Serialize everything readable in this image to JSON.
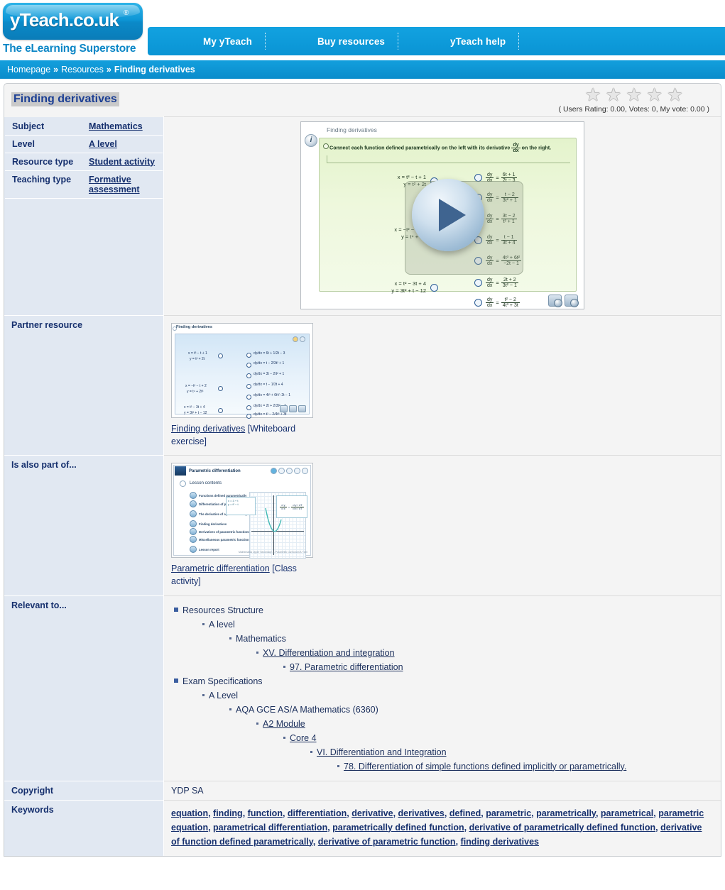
{
  "site": {
    "logo_text": "yTeach.co.uk",
    "logo_reg": "®",
    "tagline": "The eLearning Superstore"
  },
  "nav": {
    "items": [
      {
        "label": "My yTeach"
      },
      {
        "label": "Buy resources"
      },
      {
        "label": "yTeach help"
      }
    ]
  },
  "breadcrumb": {
    "home": "Homepage",
    "sep": "»",
    "resources": "Resources",
    "current": "Finding derivatives"
  },
  "page": {
    "title": "Finding derivatives"
  },
  "rating": {
    "star": "★",
    "stars_count": 5,
    "text": "( Users Rating: 0.00,   Votes: 0,   My vote: 0.00 )"
  },
  "meta": {
    "rows": [
      {
        "label": "Subject",
        "value": "Mathematics"
      },
      {
        "label": "Level",
        "value": "A level"
      },
      {
        "label": "Resource type",
        "value": "Student activity"
      },
      {
        "label": "Teaching type",
        "value": "Formative assessment"
      }
    ]
  },
  "preview": {
    "title": "Finding derivatives",
    "info_icon": "i",
    "prompt_prefix": "Connect each function defined parametrically on the left with its derivative",
    "prompt_frac_num": "dy",
    "prompt_frac_den": "dx",
    "prompt_suffix": "on the right.",
    "left_items": [
      {
        "line1": "x = t³ − t + 1",
        "line2": "y = t² + 2t"
      },
      {
        "line1": "x = −t² − t + 2",
        "line2": "y = t⁴ + 2t³"
      },
      {
        "line1": "x = t² − 3t + 4",
        "line2": "y = 3t² + t − 12"
      }
    ],
    "right_items": [
      {
        "num": "6t + 1",
        "den": "2t − 3"
      },
      {
        "num": "t − 2",
        "den": "3t² + 1"
      },
      {
        "num": "3t − 2",
        "den": "t² + 1"
      },
      {
        "num": "t − 1",
        "den": "3t + 4"
      },
      {
        "num": "4t³ + 6t²",
        "den": "−2t − 1"
      },
      {
        "num": "2t + 2",
        "den": "3t² − 1"
      },
      {
        "num": "t² − 2",
        "den": "4t³ + 3t"
      }
    ],
    "deriv_num": "dy",
    "deriv_den": "dx",
    "equals": "=",
    "play_label": "play"
  },
  "partner": {
    "label": "Partner resource",
    "thumb_title": "Finding derivatives",
    "link_text": "Finding derivatives",
    "link_suffix": " [Whiteboard exercise]"
  },
  "part_of": {
    "label": "Is also part of...",
    "thumb_title": "Parametric differentiation",
    "contents_heading": "Lesson contents",
    "contents_items": [
      "Functions defined parametrically",
      "Differentiation of parametrically defined functions",
      "The derivative of a parametrically defined function",
      "Finding derivatives",
      "Derivatives of parametric functions",
      "Miscellaneous parametric functions and their derivatives",
      "Lesson report"
    ],
    "graph_eq1": "x = 3 + t",
    "graph_eq2": "y = t² − t",
    "graph_eq3_lhs_num": "d y",
    "graph_eq3_lhs_den": "d x",
    "graph_eq3_rhs_num": "d y / dT",
    "graph_eq3_rhs_den": "d x / dT",
    "footer": "Mathematics Upper Secondary — Parametric Curriculum A +100",
    "link_text": "Parametric differentiation",
    "link_suffix": " [Class activity]"
  },
  "relevant": {
    "label": "Relevant to...",
    "nodes": [
      {
        "level": 0,
        "bullet": "square",
        "text": "Resources Structure",
        "link": false
      },
      {
        "level": 1,
        "bullet": "dot",
        "text": "A level",
        "link": false
      },
      {
        "level": 2,
        "bullet": "dot",
        "text": "Mathematics",
        "link": false
      },
      {
        "level": 3,
        "bullet": "dot",
        "text": "XV. Differentiation and integration",
        "link": true
      },
      {
        "level": 4,
        "bullet": "dot",
        "text": "97. Parametric differentiation",
        "link": true
      },
      {
        "level": 0,
        "bullet": "square",
        "text": "Exam Specifications",
        "link": false
      },
      {
        "level": 1,
        "bullet": "dot",
        "text": "A Level",
        "link": false
      },
      {
        "level": 2,
        "bullet": "dot",
        "text": "AQA GCE AS/A Mathematics (6360)",
        "link": false
      },
      {
        "level": 3,
        "bullet": "dot",
        "text": "A2 Module",
        "link": true
      },
      {
        "level": 4,
        "bullet": "dot",
        "text": "Core 4",
        "link": true
      },
      {
        "level": 5,
        "bullet": "dot",
        "text": "VI. Differentiation and Integration",
        "link": true
      },
      {
        "level": 6,
        "bullet": "dot",
        "text": "78. Differentiation of simple functions defined implicitly or parametrically.",
        "link": true
      }
    ]
  },
  "copyright": {
    "label": "Copyright",
    "value": "YDP SA"
  },
  "keywords": {
    "label": "Keywords",
    "items": [
      "equation",
      "finding",
      "function",
      "differentiation",
      "derivative",
      "derivatives",
      "defined",
      "parametric",
      "parametrically",
      "parametrical",
      "parametric equation",
      "parametrical differentiation",
      "parametrically defined function",
      "derivative of parametrically defined function",
      "derivative of function defined parametrically",
      "derivative of parametric function",
      "finding derivatives"
    ]
  },
  "colors": {
    "brand_blue": "#0b9bdb",
    "label_bg": "#e1e8f2",
    "text_navy": "#16306e",
    "panel_bg": "#f4f4f4"
  }
}
